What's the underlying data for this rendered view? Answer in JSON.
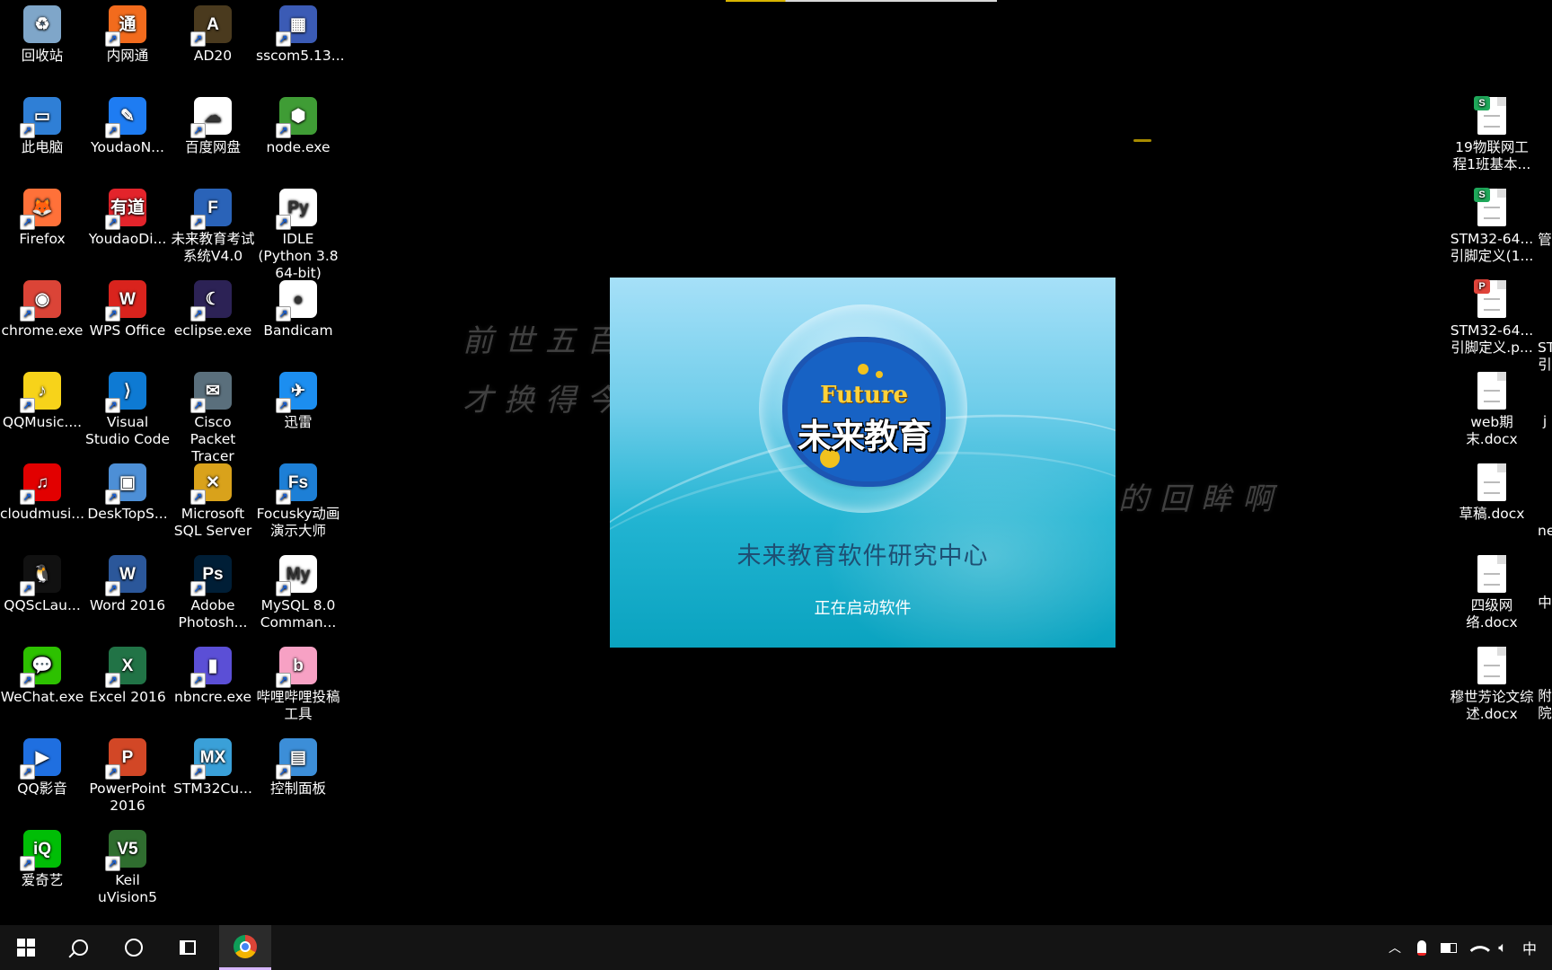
{
  "desktop": {
    "wallpaper_lines": [
      "前世五百",
      "才换得今",
      "的回眸啊"
    ],
    "icons_left": [
      {
        "label": "回收站",
        "glyph": "recycle-bin-icon",
        "color": "#7fa6c9",
        "char": "♻"
      },
      {
        "label": "内网通",
        "glyph": "neiwangtong-icon",
        "color": "#f26b1d",
        "char": "通"
      },
      {
        "label": "AD20",
        "glyph": "altium-icon",
        "color": "#4a3a1e",
        "char": "A"
      },
      {
        "label": "sscom5.13...",
        "glyph": "sscom-icon",
        "color": "#3b5bb5",
        "char": "▦"
      },
      {
        "label": "此电脑",
        "glyph": "this-pc-icon",
        "color": "#2f7fd6",
        "char": "▭"
      },
      {
        "label": "YoudaoN...",
        "glyph": "youdao-note-icon",
        "color": "#1e7cf2",
        "char": "✎"
      },
      {
        "label": "百度网盘",
        "glyph": "baidu-netdisk-icon",
        "color": "#ffffff",
        "char": "☁"
      },
      {
        "label": "node.exe",
        "glyph": "node-icon",
        "color": "#3f9c35",
        "char": "⬢"
      },
      {
        "label": "Firefox",
        "glyph": "firefox-icon",
        "color": "#ff7139",
        "char": "🦊"
      },
      {
        "label": "YoudaoDi...",
        "glyph": "youdao-dict-icon",
        "color": "#e3242b",
        "char": "有道"
      },
      {
        "label": "未来教育考试系统V4.0",
        "glyph": "future-edu-icon",
        "color": "#2a63b8",
        "char": "F"
      },
      {
        "label": "IDLE (Python 3.8 64-bit)",
        "glyph": "python-idle-icon",
        "color": "#ffffff",
        "char": "Py"
      },
      {
        "label": "chrome.exe",
        "glyph": "chrome-icon",
        "color": "#db4437",
        "char": "◉"
      },
      {
        "label": "WPS Office",
        "glyph": "wps-icon",
        "color": "#d9231d",
        "char": "W"
      },
      {
        "label": "eclipse.exe",
        "glyph": "eclipse-icon",
        "color": "#2c2255",
        "char": "☾"
      },
      {
        "label": "Bandicam",
        "glyph": "bandicam-icon",
        "color": "#ffffff",
        "char": "●"
      },
      {
        "label": "QQMusic....",
        "glyph": "qqmusic-icon",
        "color": "#f7d31a",
        "char": "♪"
      },
      {
        "label": "Visual Studio Code",
        "glyph": "vscode-icon",
        "color": "#0e7ad3",
        "char": "⟩"
      },
      {
        "label": "Cisco Packet Tracer",
        "glyph": "packet-tracer-icon",
        "color": "#5a6f7c",
        "char": "✉"
      },
      {
        "label": "迅雷",
        "glyph": "xunlei-icon",
        "color": "#1c8ef0",
        "char": "✈"
      },
      {
        "label": "cloudmusi...",
        "glyph": "netease-music-icon",
        "color": "#e20000",
        "char": "♫"
      },
      {
        "label": "DeskTopS...",
        "glyph": "desktop-share-icon",
        "color": "#4d8fd6",
        "char": "▣"
      },
      {
        "label": "Microsoft SQL Server",
        "glyph": "sql-server-icon",
        "color": "#d9a21b",
        "char": "✕"
      },
      {
        "label": "Focusky动画演示大师",
        "glyph": "focusky-icon",
        "color": "#1d7fd6",
        "char": "Fs"
      },
      {
        "label": "QQScLau...",
        "glyph": "qq-icon",
        "color": "#111111",
        "char": "🐧"
      },
      {
        "label": "Word 2016",
        "glyph": "word-icon",
        "color": "#2b579a",
        "char": "W"
      },
      {
        "label": "Adobe Photosh...",
        "glyph": "photoshop-icon",
        "color": "#001e36",
        "char": "Ps"
      },
      {
        "label": "MySQL 8.0 Comman...",
        "glyph": "mysql-icon",
        "color": "#ffffff",
        "char": "My"
      },
      {
        "label": "WeChat.exe",
        "glyph": "wechat-icon",
        "color": "#2dc100",
        "char": "💬"
      },
      {
        "label": "Excel 2016",
        "glyph": "excel-icon",
        "color": "#217346",
        "char": "X"
      },
      {
        "label": "nbncre.exe",
        "glyph": "nbncre-icon",
        "color": "#5b4fd6",
        "char": "▮"
      },
      {
        "label": "哔哩哔哩投稿工具",
        "glyph": "bilibili-icon",
        "color": "#f7a1c4",
        "char": "b"
      },
      {
        "label": "QQ影音",
        "glyph": "qq-player-icon",
        "color": "#1f6fe0",
        "char": "▶"
      },
      {
        "label": "PowerPoint 2016",
        "glyph": "powerpoint-icon",
        "color": "#d24726",
        "char": "P"
      },
      {
        "label": "STM32Cu...",
        "glyph": "stm32cube-icon",
        "color": "#3aa0d8",
        "char": "MX"
      },
      {
        "label": "控制面板",
        "glyph": "control-panel-icon",
        "color": "#3c8ed8",
        "char": "▤"
      },
      {
        "label": "爱奇艺",
        "glyph": "iqiyi-icon",
        "color": "#00be06",
        "char": "iQ"
      },
      {
        "label": "Keil uVision5",
        "glyph": "keil-icon",
        "color": "#2f6d2f",
        "char": "V5"
      }
    ],
    "icons_right": [
      {
        "label": "19物联网工程1班基本...",
        "glyph": "wps-sheet-icon",
        "badge": "S",
        "badge_color": "#1fa85a"
      },
      {
        "label": "STM32-64...引脚定义(1...",
        "glyph": "wps-sheet-icon",
        "badge": "S",
        "badge_color": "#1fa85a"
      },
      {
        "label": "STM32-64...引脚定义.p...",
        "glyph": "pdf-icon",
        "badge": "P",
        "badge_color": "#e0443a"
      },
      {
        "label": "web期末.docx",
        "glyph": "docx-icon",
        "badge": "",
        "badge_color": ""
      },
      {
        "label": "草稿.docx",
        "glyph": "docx-icon",
        "badge": "",
        "badge_color": ""
      },
      {
        "label": "四级网络.docx",
        "glyph": "docx-icon",
        "badge": "",
        "badge_color": ""
      },
      {
        "label": "穆世芳论文综述.docx",
        "glyph": "docx-icon",
        "badge": "",
        "badge_color": ""
      }
    ],
    "icons_edge": [
      "管",
      "ST 引",
      "j",
      "ne",
      "中",
      "附 院"
    ]
  },
  "splash": {
    "logo_en": "Future",
    "logo_cn": "未来教育",
    "title": "未来教育软件研究中心",
    "status": "正在启动软件",
    "colors": {
      "top": "#a6e0f8",
      "bottom": "#0aa3c0",
      "logo": "#1762c4"
    }
  },
  "taskbar": {
    "start": "start-button",
    "search": "search-button",
    "cortana": "cortana-button",
    "task_view": "task-view-button",
    "pinned": [
      "chrome"
    ],
    "tray": {
      "ime": "中"
    }
  }
}
